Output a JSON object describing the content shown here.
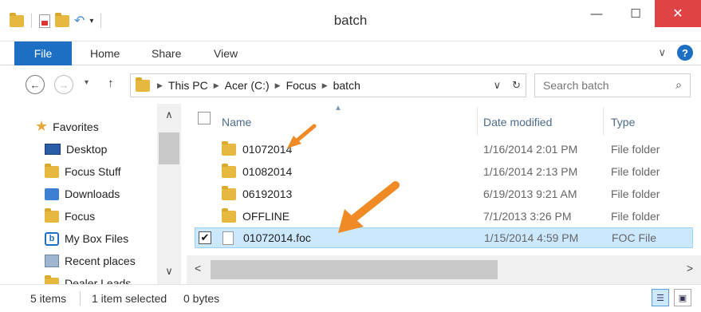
{
  "window": {
    "title": "batch",
    "controls": {
      "minimize": "—",
      "maximize": "☐",
      "close": "✕"
    }
  },
  "quick_access": {
    "dropdown": "▾"
  },
  "ribbon": {
    "tabs": [
      "File",
      "Home",
      "Share",
      "View"
    ],
    "expand_glyph": "∨",
    "help_glyph": "?"
  },
  "nav": {
    "back": "←",
    "forward": "→",
    "recent": "▾",
    "up": "↑"
  },
  "address": {
    "crumbs": [
      "This PC",
      "Acer (C:)",
      "Focus",
      "batch"
    ],
    "dropdown_glyph": "∨",
    "refresh_glyph": "↻"
  },
  "search": {
    "placeholder": "Search batch",
    "icon": "search-icon"
  },
  "nav_pane": {
    "header": "Favorites",
    "items": [
      {
        "label": "Desktop",
        "icon": "desktop-icon"
      },
      {
        "label": "Focus Stuff",
        "icon": "folder-icon"
      },
      {
        "label": "Downloads",
        "icon": "downloads-icon"
      },
      {
        "label": "Focus",
        "icon": "folder-icon"
      },
      {
        "label": "My Box Files",
        "icon": "box-icon"
      },
      {
        "label": "Recent places",
        "icon": "recent-places-icon"
      },
      {
        "label": "Dealer Leads",
        "icon": "folder-icon"
      }
    ]
  },
  "columns": {
    "name": "Name",
    "date": "Date modified",
    "type": "Type"
  },
  "files": [
    {
      "name": "01072014",
      "date": "1/16/2014 2:01 PM",
      "type": "File folder",
      "icon": "folder-icon",
      "selected": false
    },
    {
      "name": "01082014",
      "date": "1/16/2014 2:13 PM",
      "type": "File folder",
      "icon": "folder-icon",
      "selected": false
    },
    {
      "name": "06192013",
      "date": "6/19/2013 9:21 AM",
      "type": "File folder",
      "icon": "folder-icon",
      "selected": false
    },
    {
      "name": "OFFLINE",
      "date": "7/1/2013 3:26 PM",
      "type": "File folder",
      "icon": "folder-icon",
      "selected": false
    },
    {
      "name": "01072014.foc",
      "date": "1/15/2014 4:59 PM",
      "type": "FOC File",
      "icon": "file-icon",
      "selected": true
    }
  ],
  "status": {
    "count": "5 items",
    "selection": "1 item selected",
    "size": "0 bytes"
  },
  "colors": {
    "accent": "#1c6fc2",
    "close": "#e04343",
    "selection": "#cce8ff",
    "annotation_arrow": "#f08a24"
  }
}
